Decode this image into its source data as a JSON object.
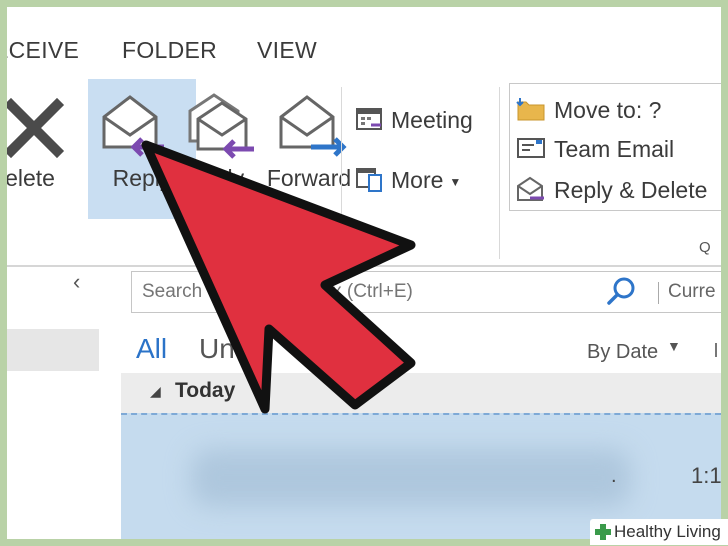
{
  "menu": {
    "tabs": [
      "ECEIVE",
      "FOLDER",
      "VIEW"
    ]
  },
  "ribbon": {
    "delete_label": "elete",
    "reply_label": "Reply",
    "reply_all_label": "eply",
    "forward_label": "Forward",
    "meeting_label": "Meeting",
    "more_label": "More",
    "quick_steps": {
      "items": [
        "Move to: ?",
        "Team Email",
        "Reply & Delete"
      ],
      "group_label": "Q"
    }
  },
  "search": {
    "placeholder": "Search Current Mailbox (Ctrl+E)",
    "visible_left": "Search",
    "visible_right": "ox (Ctrl+E)",
    "scope": "Curre"
  },
  "filters": {
    "all": "All",
    "unread": "Un"
  },
  "sort": {
    "label": "By Date"
  },
  "message_list": {
    "group_label": "Today",
    "rows": [
      {
        "time": "1:1"
      }
    ]
  },
  "watermark": "Healthy Living",
  "colors": {
    "accent": "#2b73c8",
    "selected_button": "#c9def2",
    "selected_row": "#c5dbee",
    "arrow": "#e0303f",
    "frame": "#b9d2a7"
  }
}
